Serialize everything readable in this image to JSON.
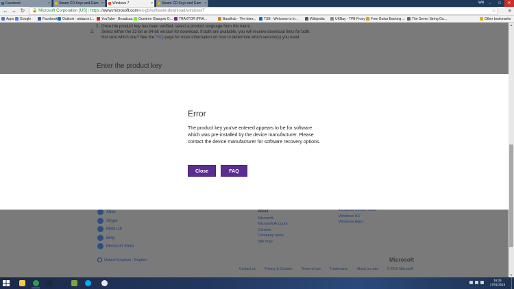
{
  "browser": {
    "tabs": [
      {
        "title": "Facebook",
        "favicon_color": "#3b5998",
        "active": false
      },
      {
        "title": "Steam CD Keys and Gam",
        "favicon_color": "#e0b020",
        "active": false
      },
      {
        "title": "Windows 7",
        "favicon_color": "#f25022",
        "active": true
      },
      {
        "title": "Steam CD Keys and Gam",
        "favicon_color": "#e0b020",
        "active": false
      }
    ],
    "profile_label": "Will",
    "address": {
      "ev_label": "Microsoft Corporation [US]",
      "url_scheme": "https://",
      "url_host": "www.microsoft.com",
      "url_path": "/en-gb/software-download/windows7"
    },
    "bookmarks": [
      {
        "label": "Apps",
        "color": "#5a6fd6"
      },
      {
        "label": "Google",
        "color": "#4285f4"
      },
      {
        "label": "Facebook",
        "color": "#3b5998"
      },
      {
        "label": "Outlook - atdazon.l...",
        "color": "#0072c6"
      },
      {
        "label": "YouTube - Broadcas...",
        "color": "#e62117"
      },
      {
        "label": "Gumtree Glasgow O...",
        "color": "#72ef36"
      },
      {
        "label": "TRAXTOR (FRA...",
        "color": "#7b1fa2"
      },
      {
        "label": "Bandhub - The Inter...",
        "color": "#e07b1f"
      },
      {
        "label": "TSB - Welcome to In...",
        "color": "#0b6fb6"
      },
      {
        "label": "Wikipedia",
        "color": "#555555"
      },
      {
        "label": "UKBay - TPB Proxy -...",
        "color": "#888888"
      },
      {
        "label": "Free Guitar Backing ...",
        "color": "#d4a017"
      },
      {
        "label": "The Seven String Gu...",
        "color": "#666666"
      },
      {
        "label": "Other bookmarks",
        "color": "#e0b020"
      }
    ]
  },
  "page": {
    "steps": [
      {
        "num": "2.",
        "text": "Once the product key has been verified, select a product language from the menu."
      },
      {
        "num": "3.",
        "text_before": "Select either the 32-bit or 64-bit version for download. If both are available, you will receive download links for both. Not sure which one? See the ",
        "link": "FAQ",
        "text_after": " page for more information on how to determine which version(s) you need."
      }
    ],
    "enter_key_heading": "Enter the product key",
    "footer_social": [
      "Xbox",
      "Skype",
      "MSN UK",
      "Bing",
      "Microsoft Store"
    ],
    "about_heading": "About",
    "about_links": [
      "Microsoft",
      "Microsoft Account",
      "Careers",
      "Company news",
      "Site map"
    ],
    "windows_links": [
      "Windows Device Store",
      "Windows 8.1",
      "Windows Apps"
    ],
    "locale": "United Kingdom - English",
    "footer_logo": "Microsoft",
    "legal_links": [
      "Contact us",
      "Privacy & Cookies",
      "Terms of use",
      "Trademarks",
      "About our ads",
      "© 2016 Microsoft"
    ]
  },
  "modal": {
    "title": "Error",
    "message": "The product key you've entered appears to be for software which was pre-installed by the device manufacturer. Please contact the device manufacturer for software recovery options.",
    "close_label": "Close",
    "faq_label": "FAQ",
    "button_color": "#5c2d91"
  },
  "taskbar": {
    "apps": [
      {
        "name": "file-explorer-icon",
        "color": "#f2c94c",
        "active": false
      },
      {
        "name": "chrome-icon",
        "color": "#2e9e4f",
        "active": true
      },
      {
        "name": "steam-icon",
        "color": "#1b2838",
        "active": false
      },
      {
        "name": "sketchup-icon",
        "color": "#7aa33a",
        "active": false
      },
      {
        "name": "skype-icon",
        "color": "#00aff0",
        "active": false
      },
      {
        "name": "itunes-icon",
        "color": "#e8e8f0",
        "active": false
      }
    ],
    "time": "16:25",
    "date": "17/01/2016"
  }
}
